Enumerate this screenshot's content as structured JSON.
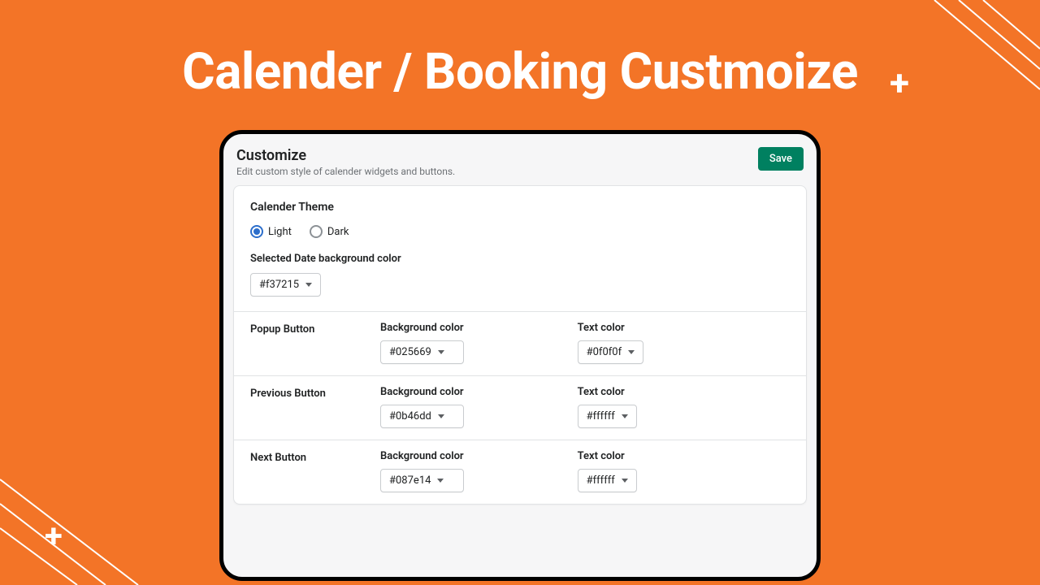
{
  "headline": "Calender / Booking Custmoize",
  "panel": {
    "title": "Customize",
    "subtitle": "Edit custom style of calender widgets and buttons.",
    "save_label": "Save"
  },
  "theme": {
    "section_title": "Calender Theme",
    "options": {
      "light": "Light",
      "dark": "Dark"
    },
    "selected": "light",
    "selected_date_label": "Selected Date background color",
    "selected_date_value": "#f37215"
  },
  "labels": {
    "bg": "Background color",
    "text": "Text color"
  },
  "buttons": [
    {
      "name": "Popup Button",
      "bg": "#025669",
      "text": "#0f0f0f"
    },
    {
      "name": "Previous Button",
      "bg": "#0b46dd",
      "text": "#ffffff"
    },
    {
      "name": "Next Button",
      "bg": "#087e14",
      "text": "#ffffff"
    }
  ]
}
